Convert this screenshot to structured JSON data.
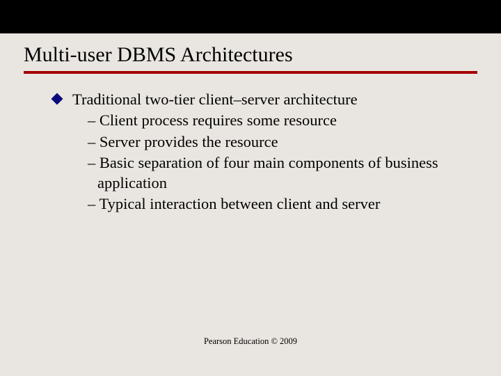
{
  "title": "Multi-user DBMS Architectures",
  "main_bullet": "Traditional two-tier client–server architecture",
  "subs": {
    "s1": "– Client process requires some resource",
    "s2": "– Server provides the resource",
    "s3": "– Basic separation of four main components of business application",
    "s4": "– Typical interaction between client and server"
  },
  "footer": "Pearson Education © 2009"
}
